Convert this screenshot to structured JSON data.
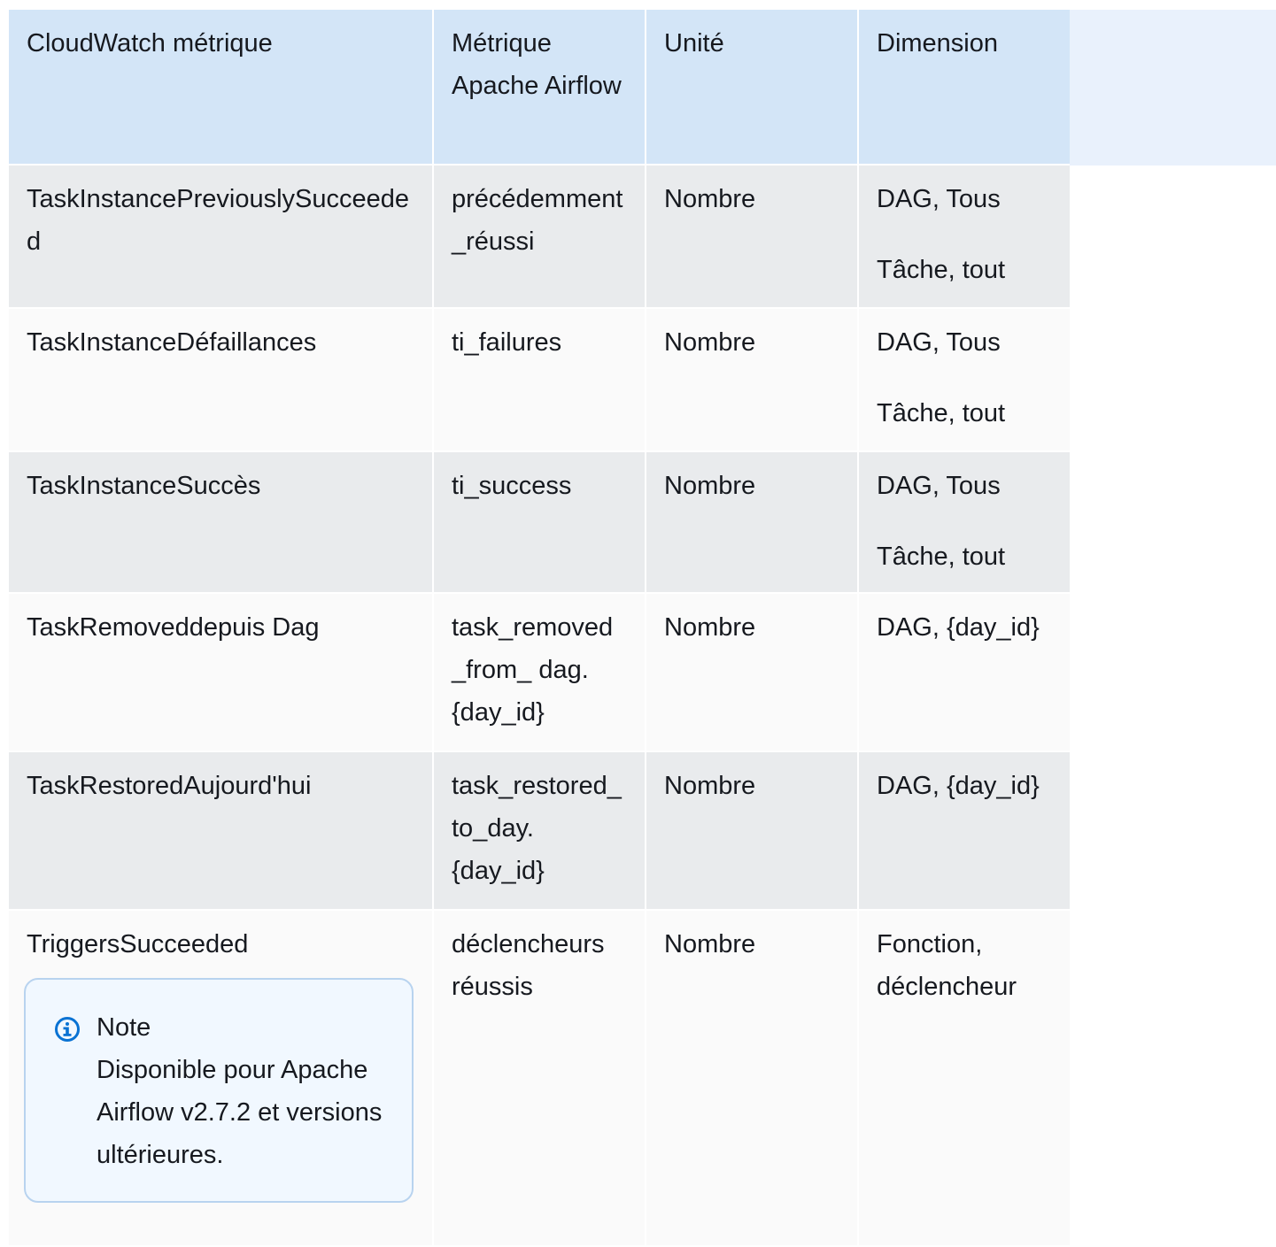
{
  "table": {
    "headers": [
      "CloudWatch métrique",
      "Métrique Apache Airflow",
      "Unité",
      "Dimension"
    ],
    "rows": [
      {
        "metric": "TaskInstancePreviouslySucceeded",
        "airflow": "précédemment _réussi",
        "unit": "Nombre",
        "dimension": [
          "DAG, Tous",
          "Tâche, tout"
        ]
      },
      {
        "metric": "TaskInstanceDéfaillances",
        "airflow": "ti_failures",
        "unit": "Nombre",
        "dimension": [
          "DAG, Tous",
          "Tâche, tout"
        ]
      },
      {
        "metric": "TaskInstanceSuccès",
        "airflow": "ti_success",
        "unit": "Nombre",
        "dimension": [
          "DAG, Tous",
          "Tâche, tout"
        ]
      },
      {
        "metric": "TaskRemoveddepuis Dag",
        "airflow": "task_removed_from_ dag. {day_id}",
        "unit": "Nombre",
        "dimension": [
          "DAG, {day_id}"
        ]
      },
      {
        "metric": "TaskRestoredAujourd'hui",
        "airflow": "task_restored_to_day. {day_id}",
        "unit": "Nombre",
        "dimension": [
          "DAG, {day_id}"
        ]
      },
      {
        "metric": "TriggersSucceeded",
        "airflow": "déclencheurs réussis",
        "unit": "Nombre",
        "dimension": [
          "Fonction, déclencheur"
        ],
        "note": {
          "title": "Note",
          "body": "Disponible pour Apache Airflow v2.7.2 et versions ultérieures.",
          "icon": "info-icon"
        }
      }
    ]
  },
  "colors": {
    "header_bg": "#d3e5f7",
    "header_band": "#e9f1fc",
    "row_odd": "#e9ebed",
    "row_even": "#fafafa",
    "note_bg": "#f1f8ff",
    "note_border": "#b8d3ef",
    "info_icon": "#0972d3"
  }
}
